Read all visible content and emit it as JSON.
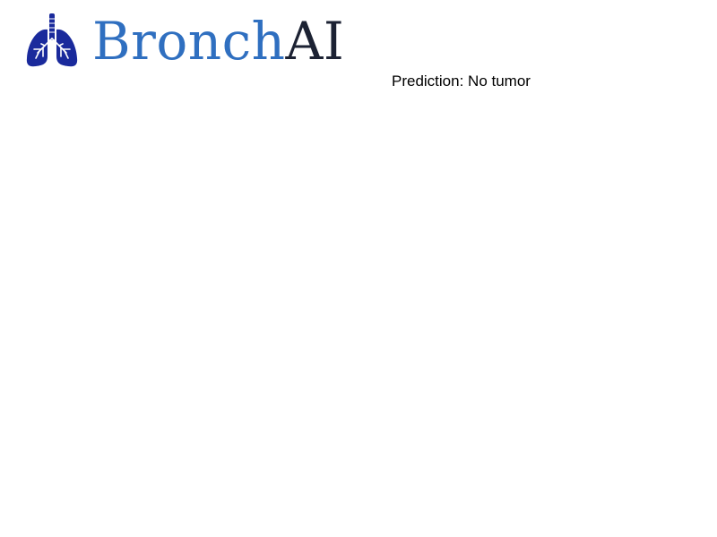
{
  "logo": {
    "icon": "lungs-icon",
    "brand_part_1": "Bronch",
    "brand_part_2": "AI",
    "colors": {
      "lungs": "#1a2a9c",
      "brand_part_1": "#2f6fc0",
      "brand_part_2": "#1c2233"
    }
  },
  "result": {
    "label": "Prediction: No tumor"
  }
}
